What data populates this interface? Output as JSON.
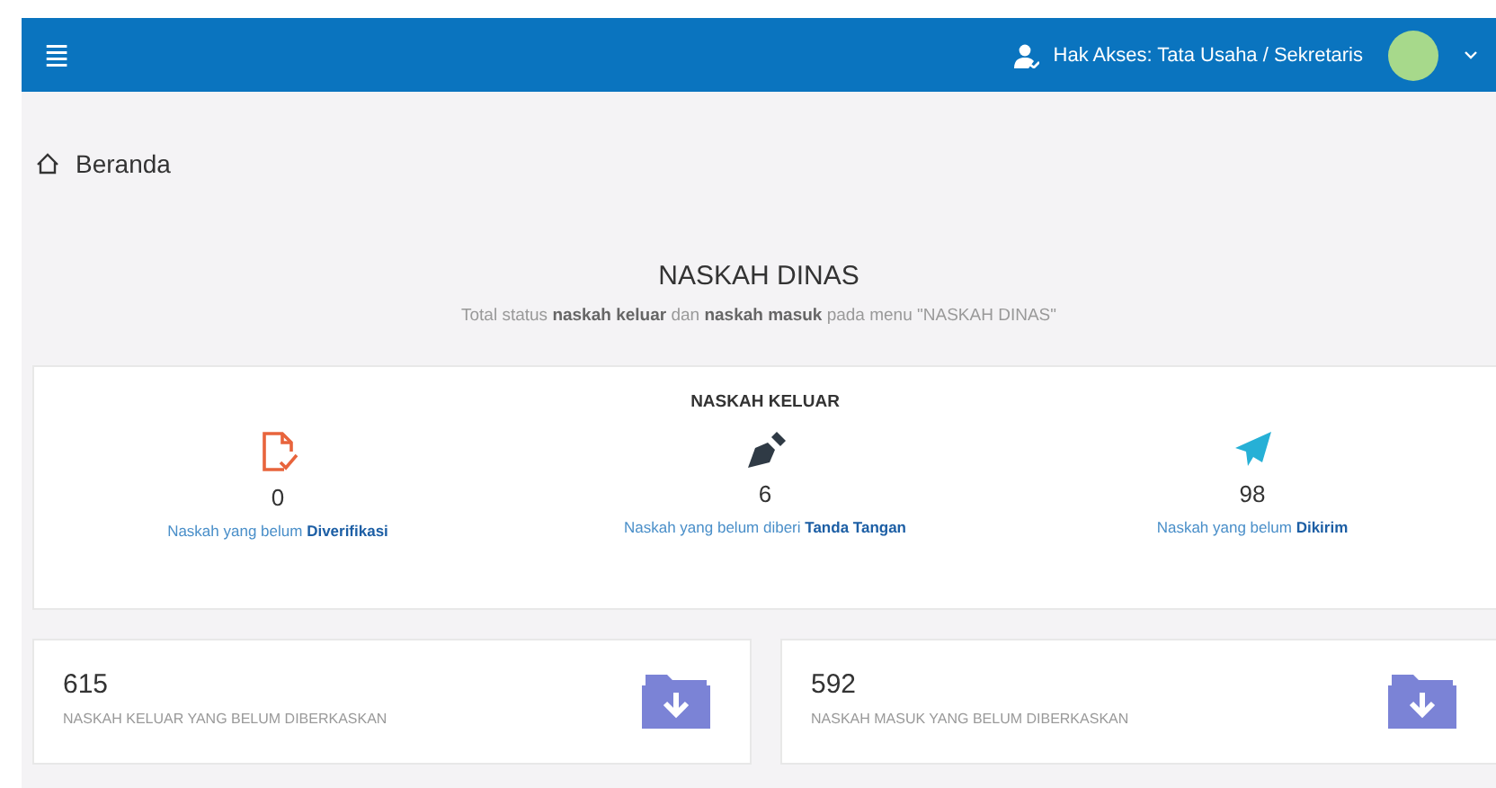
{
  "header": {
    "menu_icon": "≣",
    "access": "Hak Akses: Tata Usaha / Sekretaris"
  },
  "breadcrumb": {
    "label": "Beranda"
  },
  "section": {
    "title": "NASKAH DINAS",
    "subtitle": "Total status **naskah keluar** dan **naskah masuk** pada menu \"NASKAH DINAS\""
  },
  "outgoing": {
    "title": "NASKAH KELUAR",
    "stats": [
      {
        "kind": "verify",
        "count": "0",
        "label": "Naskah yang belum **Diverifikasi**"
      },
      {
        "kind": "sign",
        "count": "6",
        "label": "Naskah yang belum diberi **Tanda Tangan**"
      },
      {
        "kind": "send",
        "count": "98",
        "label": "Naskah yang belum **Dikirim**"
      }
    ]
  },
  "archive_cards": [
    {
      "count": "615",
      "label": "NASKAH KELUAR YANG BELUM DIBERKASKAN"
    },
    {
      "count": "592",
      "label": "NASKAH MASUK YANG BELUM DIBERKASKAN"
    }
  ]
}
